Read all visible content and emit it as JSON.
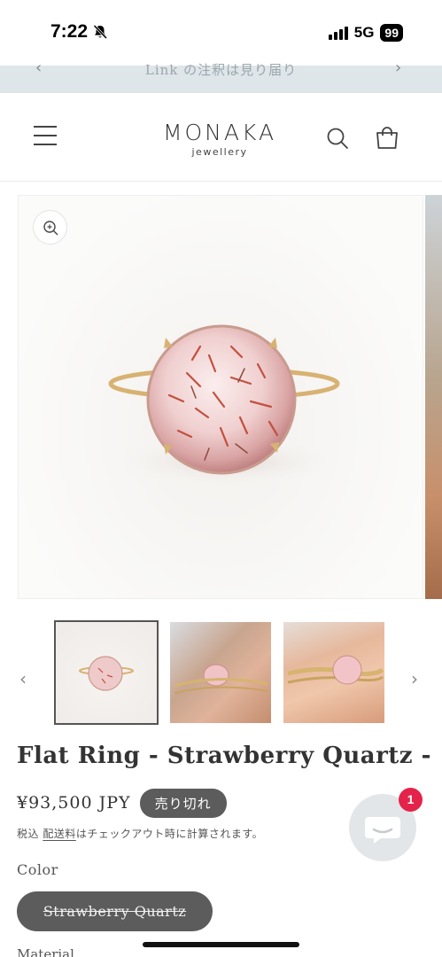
{
  "status_bar": {
    "time": "7:22",
    "network": "5G",
    "battery": "99",
    "icons": [
      "bell-slash-icon",
      "signal-icon"
    ]
  },
  "announcement": {
    "text": "Link の注釈は見り届り",
    "prev_icon": "chevron-left-icon",
    "next_icon": "chevron-right-icon"
  },
  "header": {
    "logo_main": "MONAKA",
    "logo_sub": "jewellery",
    "icons": [
      "menu-icon",
      "search-icon",
      "cart-icon"
    ]
  },
  "gallery": {
    "zoom_icon": "zoom-in-icon",
    "thumbnails_count": 3,
    "prev_arrow": "‹",
    "next_arrow": "›"
  },
  "product": {
    "title": "Flat Ring - Strawberry Quartz -",
    "price": "¥93,500 JPY",
    "sold_out_badge": "売り切れ",
    "tax_prefix": "税込 ",
    "tax_link": "配送料",
    "tax_suffix": "はチェックアウト時に計算されます。",
    "color_label": "Color",
    "color_value": "Strawberry Quartz",
    "material_label": "Material"
  },
  "chat": {
    "badge_count": "1",
    "icon": "chat-icon"
  },
  "colors": {
    "badge_bg": "#5c5c5c",
    "chat_badge": "#e4234a",
    "announcement_bg": "#dfe6ea"
  }
}
